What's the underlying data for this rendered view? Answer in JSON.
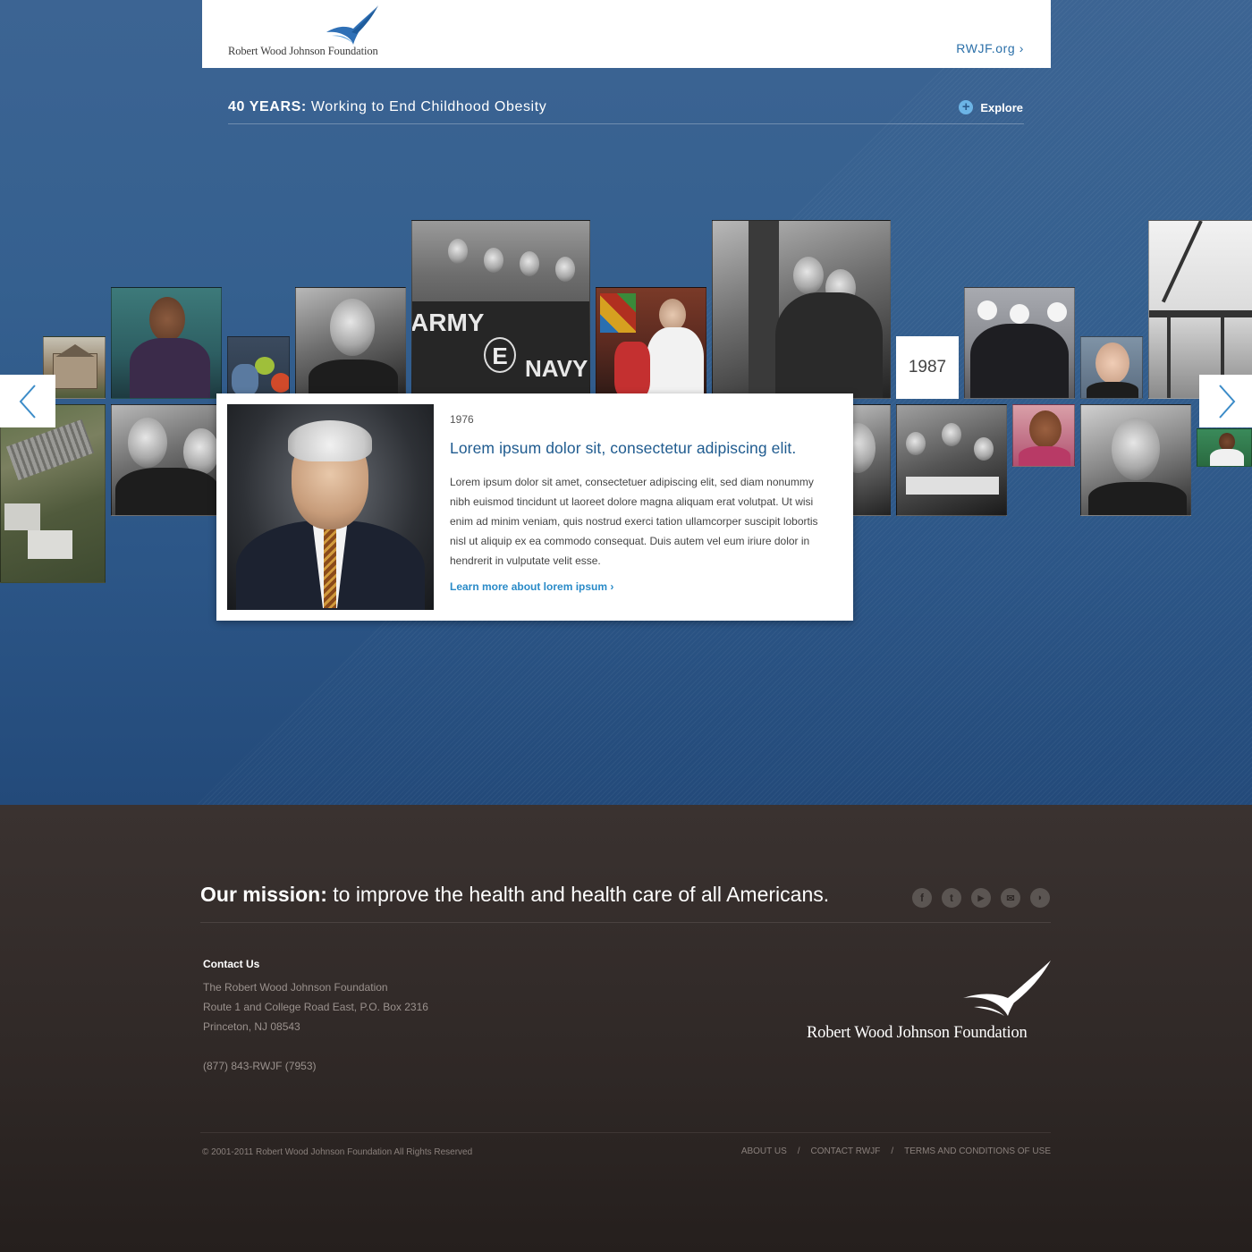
{
  "header": {
    "logo_text": "Robert Wood Johnson Foundation",
    "site_link": "RWJF.org ›"
  },
  "titlebar": {
    "prefix": "40 YEARS:",
    "title": "Working to End Childhood Obesity",
    "explore_label": "Explore"
  },
  "timeline": {
    "year_tile": "1987",
    "photo_captions": {
      "army_banner_left": "ARMY",
      "army_banner_center": "E",
      "army_banner_right": "NAVY"
    }
  },
  "feature": {
    "year": "1976",
    "headline": "Lorem ipsum dolor sit, consectetur adipiscing elit.",
    "body": "Lorem ipsum dolor sit amet, consectetuer adipiscing elit, sed diam nonummy nibh euismod tincidunt ut laoreet dolore magna aliquam erat volutpat. Ut wisi enim ad minim veniam, quis nostrud exerci tation ullamcorper suscipit lobortis nisl ut aliquip ex ea commodo consequat. Duis autem vel eum iriure dolor in hendrerit in vulputate velit esse.",
    "link": "Learn more about lorem ipsum ›"
  },
  "footer": {
    "mission_label": "Our mission:",
    "mission_text": "to improve the health and health care of all Americans.",
    "social_icons": [
      "facebook-icon",
      "twitter-icon",
      "youtube-icon",
      "email-icon",
      "rss-icon"
    ],
    "contact": {
      "heading": "Contact Us",
      "line1": "The Robert Wood Johnson Foundation",
      "line2": "Route 1 and College Road East, P.O. Box 2316",
      "line3": "Princeton, NJ 08543",
      "phone": "(877) 843-RWJF (7953)"
    },
    "logo_text": "Robert Wood Johnson Foundation",
    "copyright": "© 2001-2011 Robert Wood Johnson Foundation   All Rights Reserved",
    "links": [
      "ABOUT US",
      "CONTACT RWJF",
      "TERMS AND CONDITIONS OF USE"
    ],
    "link_separator": "/"
  },
  "colors": {
    "hero_blue": "#35608f",
    "link_blue": "#2a8bc8",
    "headline_blue": "#1f5b8f",
    "footer_brown": "#2f2826"
  }
}
